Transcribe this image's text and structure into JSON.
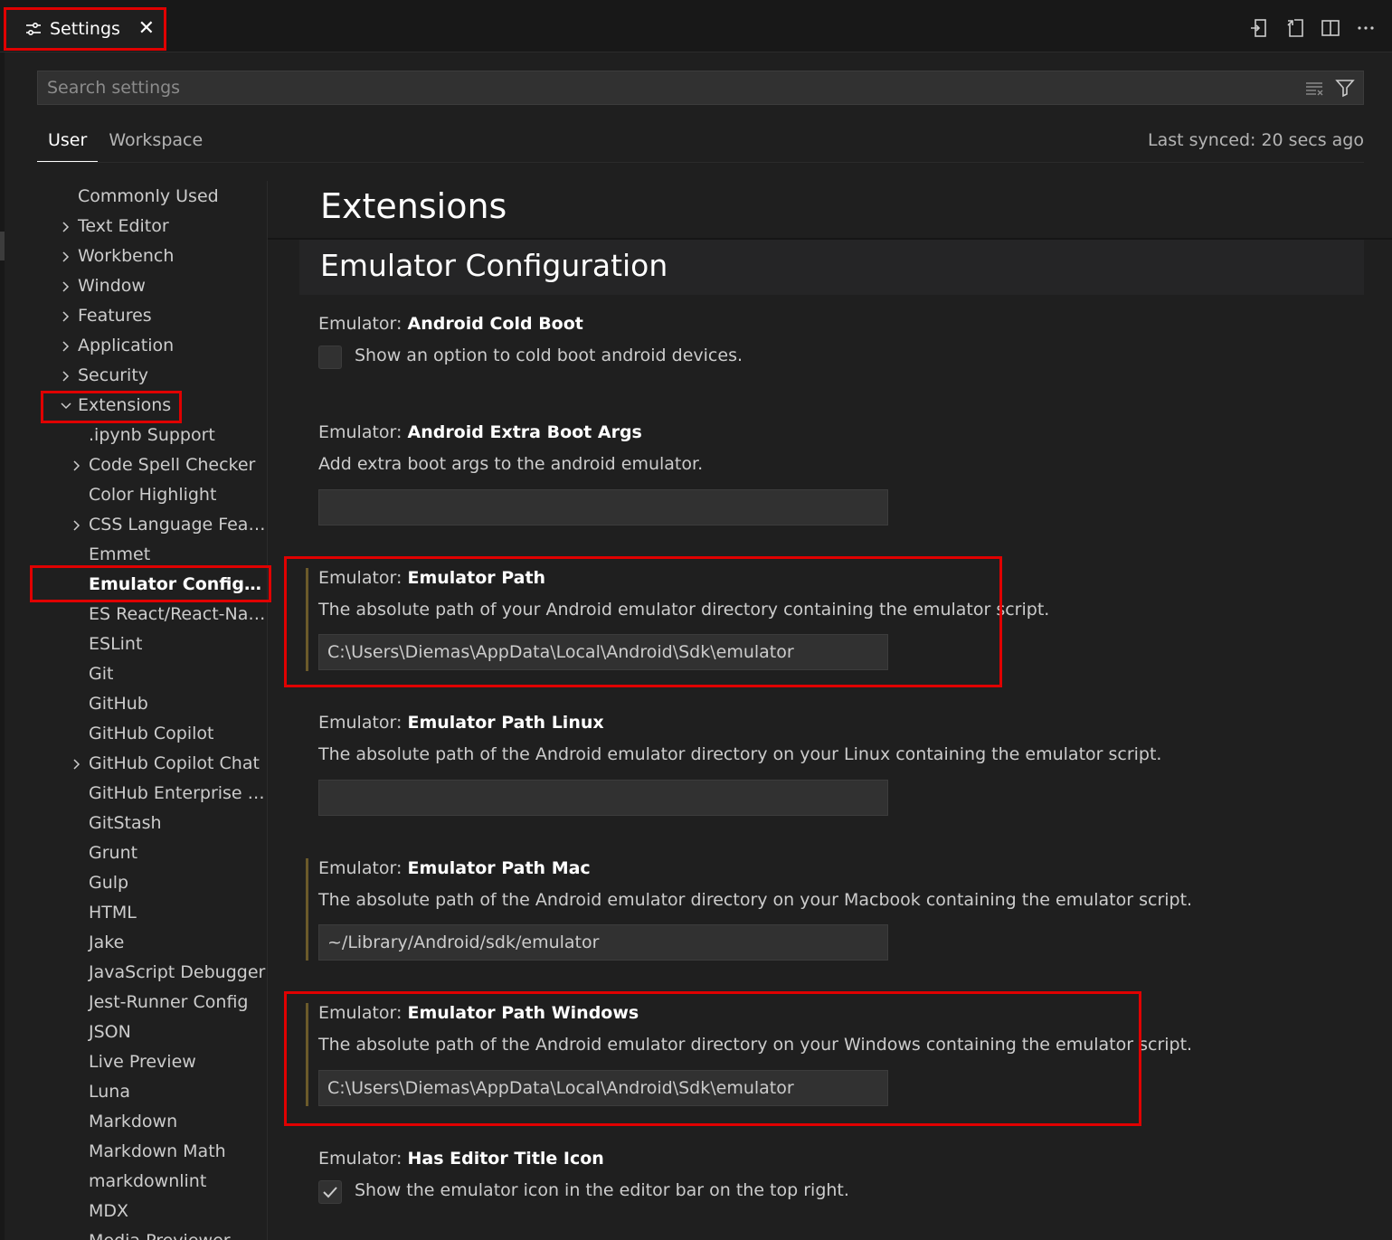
{
  "tab": {
    "label": "Settings",
    "close": "✕"
  },
  "search": {
    "placeholder": "Search settings"
  },
  "scope_tabs": [
    "User",
    "Workspace"
  ],
  "last_synced": "Last synced: 20 secs ago",
  "toc": [
    "Commonly Used",
    "Text Editor",
    "Workbench",
    "Window",
    "Features",
    "Application",
    "Security",
    "Extensions",
    ".ipynb Support",
    "Code Spell Checker",
    "Color Highlight",
    "CSS Language Featur...",
    "Emmet",
    "Emulator Configur...",
    "ES React/React-Nativ...",
    "ESLint",
    "Git",
    "GitHub",
    "GitHub Copilot",
    "GitHub Copilot Chat",
    "GitHub Enterprise Se...",
    "GitStash",
    "Grunt",
    "Gulp",
    "HTML",
    "Jake",
    "JavaScript Debugger",
    "Jest-Runner Config",
    "JSON",
    "Live Preview",
    "Luna",
    "Markdown",
    "Markdown Math",
    "markdownlint",
    "MDX",
    "Media Previewer"
  ],
  "main": {
    "section_title": "Extensions",
    "category_title": "Emulator Configuration",
    "settings": [
      {
        "category": "Emulator: ",
        "name": "Android Cold Boot",
        "description": "Show an option to cold boot android devices.",
        "checked": false
      },
      {
        "category": "Emulator: ",
        "name": "Android Extra Boot Args",
        "description": "Add extra boot args to the android emulator.",
        "value": ""
      },
      {
        "category": "Emulator: ",
        "name": "Emulator Path",
        "description": "The absolute path of your Android emulator directory containing the emulator script.",
        "value": "C:\\Users\\Diemas\\AppData\\Local\\Android\\Sdk\\emulator"
      },
      {
        "category": "Emulator: ",
        "name": "Emulator Path Linux",
        "description": "The absolute path of the Android emulator directory on your Linux containing the emulator script.",
        "value": ""
      },
      {
        "category": "Emulator: ",
        "name": "Emulator Path Mac",
        "description": "The absolute path of the Android emulator directory on your Macbook containing the emulator script.",
        "value": "~/Library/Android/sdk/emulator"
      },
      {
        "category": "Emulator: ",
        "name": "Emulator Path Windows",
        "description": "The absolute path of the Android emulator directory on your Windows containing the emulator script.",
        "value": "C:\\Users\\Diemas\\AppData\\Local\\Android\\Sdk\\emulator"
      },
      {
        "category": "Emulator: ",
        "name": "Has Editor Title Icon",
        "description": "Show the emulator icon in the editor bar on the top right.",
        "checked": true
      }
    ]
  },
  "colors": {
    "accent_highlight": "#e00000",
    "background": "#1f1f1f",
    "modified_bar": "#6b5a2a"
  }
}
